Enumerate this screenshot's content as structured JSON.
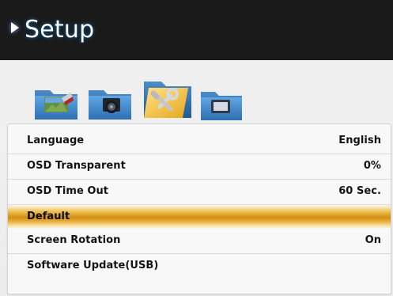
{
  "header": {
    "title": "Setup"
  },
  "icons": [
    {
      "name": "picture-folder-icon"
    },
    {
      "name": "camera-folder-icon"
    },
    {
      "name": "tools-folder-icon"
    },
    {
      "name": "display-folder-icon"
    }
  ],
  "menu": {
    "items": [
      {
        "label": "Language",
        "value": "English"
      },
      {
        "label": "OSD Transparent",
        "value": "0%"
      },
      {
        "label": "OSD Time Out",
        "value": "60 Sec."
      },
      {
        "label": "Default",
        "value": ""
      },
      {
        "label": "Screen Rotation",
        "value": "On"
      },
      {
        "label": "Software Update(USB)",
        "value": ""
      }
    ]
  },
  "colors": {
    "header_background": "#1a1a1a",
    "selection_gold": "#d89a1d",
    "panel_background": "#f8f8f8"
  }
}
